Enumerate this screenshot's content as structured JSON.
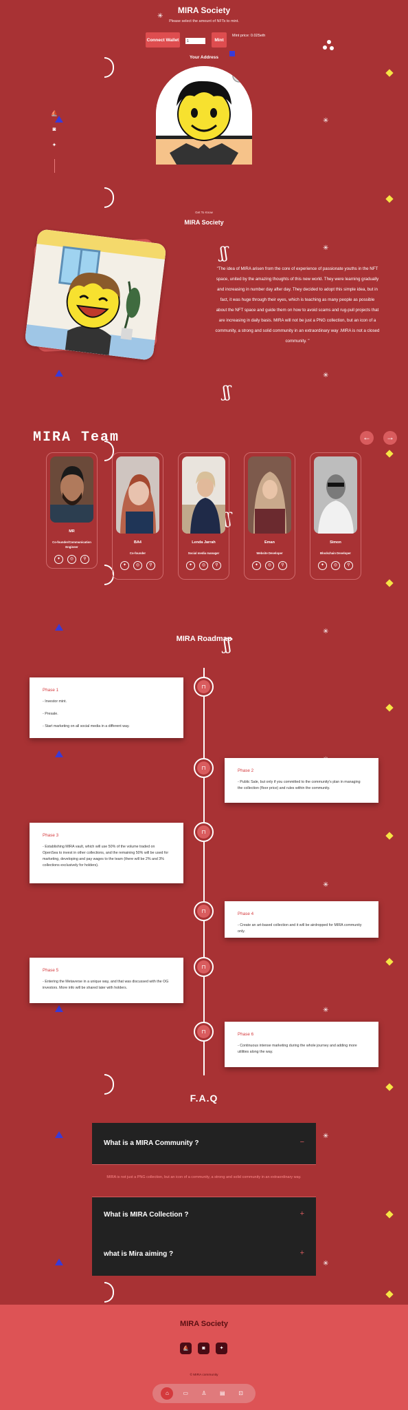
{
  "hero": {
    "title": "MIRA Society",
    "subtitle": "Please select the amount of NFTs to mint.",
    "connect_label": "Connect Wallet",
    "mint_input_value": "1",
    "mint_label": "Mint",
    "mint_price": "Mint price: 0.025eth",
    "your_address": "Your Address"
  },
  "about": {
    "kicker": "Get To Know",
    "title": "MIRA Society",
    "text": "\"The idea of MIRA arisen from the core of experience of passionate youths in the NFT space, united by the amazing thoughts of this new world. They were learning gradually and increasing in number day after day. They decided to adopt this simple idea, but in fact, it was huge through their eyes, which is teaching as many people as possible about the NFT space and guide them on how to avoid scams and rug-pull projects that are increasing in daily basis. MIRA will not be just a PNG collection, but an icon of a community, a strong and solid community in an extraordinary way .MIRA is not a closed community. \""
  },
  "team": {
    "title": "MIRA Team",
    "members": [
      {
        "name": "MR",
        "role": "Co-founder/Communication Engineer"
      },
      {
        "name": "BA4",
        "role": "Co-founder"
      },
      {
        "name": "Lenda Jarrah",
        "role": "Social media manager"
      },
      {
        "name": "Eman",
        "role": "Website Developer"
      },
      {
        "name": "Simon",
        "role": "Blockchain Developer"
      }
    ]
  },
  "roadmap": {
    "title": "MIRA Roadmap",
    "phases": [
      {
        "title": "Phase 1",
        "lines": [
          "- Investor mint.",
          "- Presale.",
          "- Start marketing on all social media in a different way."
        ]
      },
      {
        "title": "Phase 2",
        "lines": [
          "- Public Sale, but only if you committed to the community's plan in managing the collection (floor price) and rules within the community."
        ]
      },
      {
        "title": "Phase 3",
        "lines": [
          "- Establishing MIRA vault, which will use 50% of the volume traded on OpenSea to invest in other collections, and the remaining 50% will be used for marketing, developing and pay wages to the team (there will be 2% and 3% collections exclusively for holders)."
        ]
      },
      {
        "title": "Phase 4",
        "lines": [
          "- Create an art-based collection and it will be airdropped for MIRA community only."
        ]
      },
      {
        "title": "Phase 5",
        "lines": [
          "- Entering the Metaverse in a unique way, and that was discussed with the OG investors. More info will be shared later with holders."
        ]
      },
      {
        "title": "Phase 6",
        "lines": [
          "- Continuous intense marketing during the whole journey and adding more utilities along the way."
        ]
      }
    ]
  },
  "faq": {
    "title": "F.A.Q",
    "items": [
      {
        "question": "What is a MIRA Community ?",
        "toggle": "−",
        "answer": "MIRA is not just a PNG collection, but an icon of a community, a strong and solid community in an extraordinary way."
      },
      {
        "question": "What is MIRA Collection ?",
        "toggle": "+"
      },
      {
        "question": "what is Mira aiming ?",
        "toggle": "+"
      }
    ]
  },
  "footer": {
    "title": "MIRA Society",
    "copyright": "© MIRA community"
  },
  "colors": {
    "background": "#a83234",
    "accent": "#de4d4f",
    "footer": "#dd5355",
    "faq_panel": "#222222"
  },
  "icons": {
    "side": [
      "opensea-icon",
      "discord-icon",
      "twitter-icon"
    ],
    "member_socials": [
      "twitter-icon",
      "instagram-icon",
      "link-icon"
    ],
    "bottom_nav": [
      "home-icon",
      "about-icon",
      "team-icon",
      "roadmap-icon",
      "faq-icon"
    ]
  }
}
